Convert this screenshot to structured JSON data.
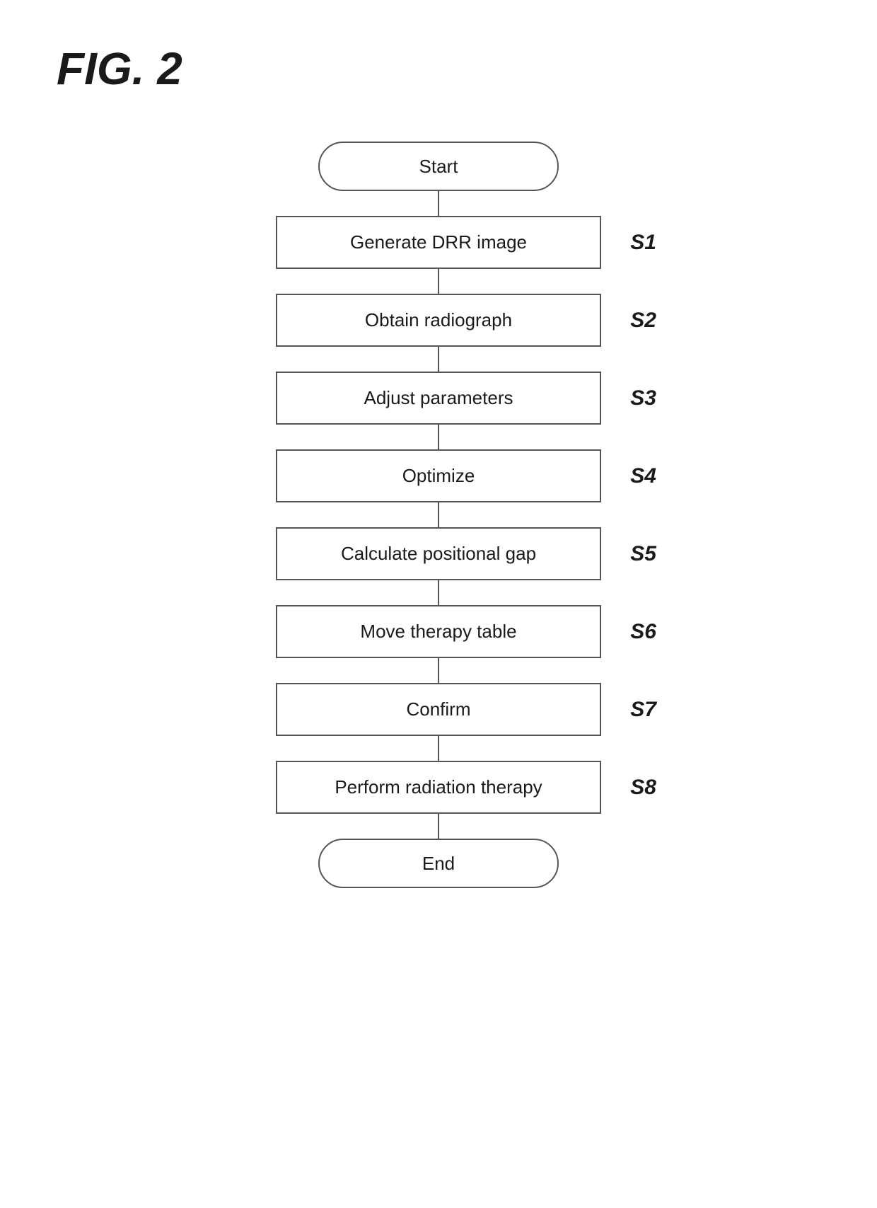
{
  "title": "FIG. 2",
  "flowchart": {
    "nodes": [
      {
        "id": "start",
        "type": "terminal",
        "label": "Start",
        "step": null
      },
      {
        "id": "s1",
        "type": "process",
        "label": "Generate DRR image",
        "step": "S1"
      },
      {
        "id": "s2",
        "type": "process",
        "label": "Obtain radiograph",
        "step": "S2"
      },
      {
        "id": "s3",
        "type": "process",
        "label": "Adjust parameters",
        "step": "S3"
      },
      {
        "id": "s4",
        "type": "process",
        "label": "Optimize",
        "step": "S4"
      },
      {
        "id": "s5",
        "type": "process",
        "label": "Calculate positional gap",
        "step": "S5"
      },
      {
        "id": "s6",
        "type": "process",
        "label": "Move therapy table",
        "step": "S6"
      },
      {
        "id": "s7",
        "type": "process",
        "label": "Confirm",
        "step": "S7"
      },
      {
        "id": "s8",
        "type": "process",
        "label": "Perform radiation therapy",
        "step": "S8"
      },
      {
        "id": "end",
        "type": "terminal",
        "label": "End",
        "step": null
      }
    ]
  }
}
